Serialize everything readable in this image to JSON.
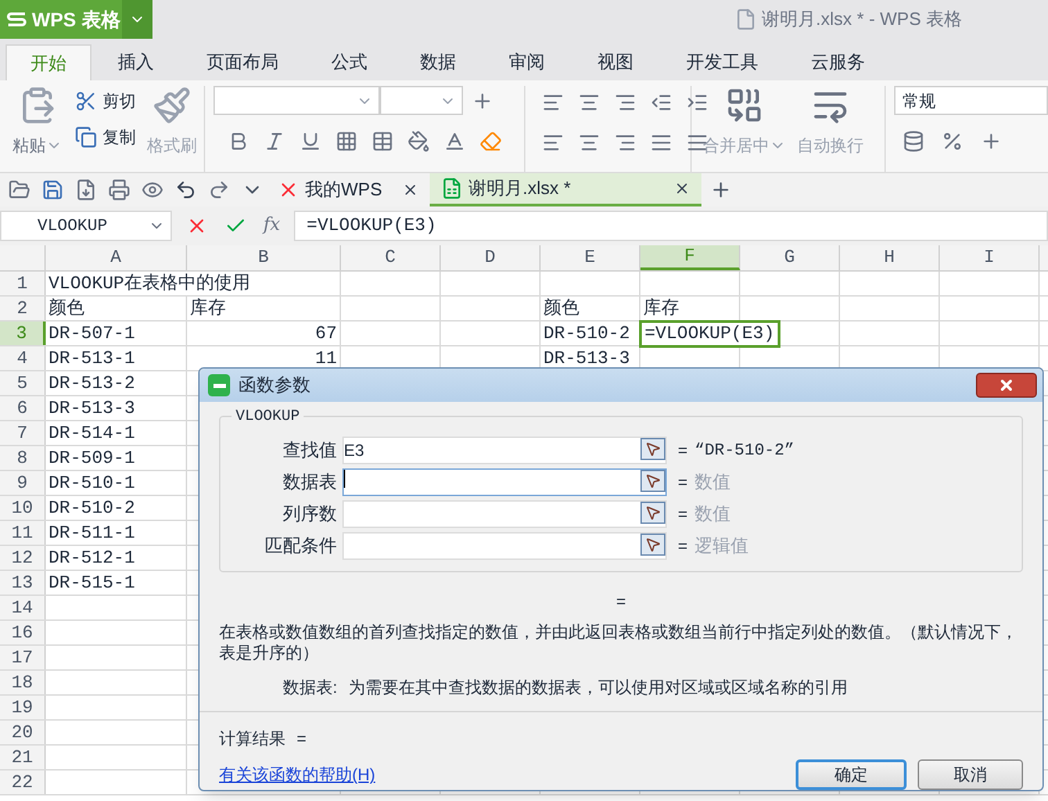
{
  "app_button": {
    "label": "WPS 表格"
  },
  "window_title": "谢明月.xlsx * - WPS 表格",
  "menu_tabs": [
    {
      "label": "开始",
      "selected": true
    },
    {
      "label": "插入",
      "selected": false
    },
    {
      "label": "页面布局",
      "selected": false
    },
    {
      "label": "公式",
      "selected": false
    },
    {
      "label": "数据",
      "selected": false
    },
    {
      "label": "审阅",
      "selected": false
    },
    {
      "label": "视图",
      "selected": false
    },
    {
      "label": "开发工具",
      "selected": false
    },
    {
      "label": "云服务",
      "selected": false
    }
  ],
  "ribbon": {
    "paste": "粘贴",
    "cut": "剪切",
    "copy": "复制",
    "format_painter": "格式刷",
    "merge_center": "合并居中",
    "wrap_text": "自动换行",
    "number_format": "常规"
  },
  "doc_tabs": [
    {
      "label": "我的WPS",
      "selected": false,
      "kind": "home"
    },
    {
      "label": "谢明月.xlsx *",
      "selected": true,
      "kind": "sheet"
    }
  ],
  "formula_bar": {
    "name_box": "VLOOKUP",
    "fx_label": "fx",
    "formula": "=VLOOKUP(E3)"
  },
  "sheet": {
    "columns": [
      {
        "label": "A",
        "selected": false
      },
      {
        "label": "B",
        "selected": false
      },
      {
        "label": "C",
        "selected": false
      },
      {
        "label": "D",
        "selected": false
      },
      {
        "label": "E",
        "selected": false
      },
      {
        "label": "F",
        "selected": true
      },
      {
        "label": "G",
        "selected": false
      },
      {
        "label": "H",
        "selected": false
      },
      {
        "label": "I",
        "selected": false
      }
    ],
    "rows": [
      {
        "number": "1",
        "selected": false,
        "cells": [
          {
            "text": "VLOOKUP在表格中的使用",
            "kind": "text"
          }
        ]
      },
      {
        "number": "2",
        "selected": false,
        "cells": [
          {
            "text": "颜色",
            "kind": "text"
          },
          {
            "text": "库存",
            "kind": "text"
          },
          null,
          null,
          {
            "text": "颜色",
            "kind": "text"
          },
          {
            "text": "库存",
            "kind": "text"
          }
        ]
      },
      {
        "number": "3",
        "selected": true,
        "cells": [
          {
            "text": "DR-507-1",
            "kind": "text"
          },
          {
            "text": "67",
            "kind": "number"
          },
          null,
          null,
          {
            "text": "DR-510-2",
            "kind": "text"
          },
          {
            "text": "=VLOOKUP(E3)",
            "kind": "editing"
          }
        ]
      },
      {
        "number": "4",
        "selected": false,
        "cells": [
          {
            "text": "DR-513-1",
            "kind": "text"
          },
          {
            "text": "11",
            "kind": "number"
          },
          null,
          null,
          {
            "text": "DR-513-3",
            "kind": "text"
          }
        ]
      },
      {
        "number": "5",
        "selected": false,
        "cells": [
          {
            "text": "DR-513-2",
            "kind": "text"
          }
        ]
      },
      {
        "number": "6",
        "selected": false,
        "cells": [
          {
            "text": "DR-513-3",
            "kind": "text"
          }
        ]
      },
      {
        "number": "7",
        "selected": false,
        "cells": [
          {
            "text": "DR-514-1",
            "kind": "text"
          }
        ]
      },
      {
        "number": "8",
        "selected": false,
        "cells": [
          {
            "text": "DR-509-1",
            "kind": "text"
          }
        ]
      },
      {
        "number": "9",
        "selected": false,
        "cells": [
          {
            "text": "DR-510-1",
            "kind": "text"
          }
        ]
      },
      {
        "number": "10",
        "selected": false,
        "cells": [
          {
            "text": "DR-510-2",
            "kind": "text"
          }
        ]
      },
      {
        "number": "11",
        "selected": false,
        "cells": [
          {
            "text": "DR-511-1",
            "kind": "text"
          }
        ]
      },
      {
        "number": "12",
        "selected": false,
        "cells": [
          {
            "text": "DR-512-1",
            "kind": "text"
          }
        ]
      },
      {
        "number": "13",
        "selected": false,
        "cells": [
          {
            "text": "DR-515-1",
            "kind": "text"
          }
        ]
      },
      {
        "number": "14",
        "selected": false,
        "cells": []
      },
      {
        "number": "16",
        "selected": false,
        "cells": []
      },
      {
        "number": "17",
        "selected": false,
        "cells": []
      },
      {
        "number": "18",
        "selected": false,
        "cells": []
      },
      {
        "number": "19",
        "selected": false,
        "cells": []
      },
      {
        "number": "20",
        "selected": false,
        "cells": []
      },
      {
        "number": "21",
        "selected": false,
        "cells": []
      },
      {
        "number": "22",
        "selected": false,
        "cells": []
      }
    ]
  },
  "dialog": {
    "title": "函数参数",
    "function_name": "VLOOKUP",
    "arguments": [
      {
        "label": "查找值",
        "value": "E3",
        "focused": false,
        "sign": "=",
        "result": "“DR-510-2”",
        "result_is_hint": false
      },
      {
        "label": "数据表",
        "focused": true,
        "sign": "=",
        "result": "数值",
        "result_is_hint": true
      },
      {
        "label": "列序数",
        "focused": false,
        "sign": "=",
        "result": "数值",
        "result_is_hint": true
      },
      {
        "label": "匹配条件",
        "focused": false,
        "sign": "=",
        "result": "逻辑值",
        "result_is_hint": true
      }
    ],
    "formula_sign": "=",
    "description": "在表格或数值数组的首列查找指定的数值，并由此返回表格或数组当前行中指定列处的数值。（默认情况下，表是升序的）",
    "argument_help": {
      "label": "数据表:",
      "text": "为需要在其中查找数据的数据表，可以使用对区域或区域名称的引用"
    },
    "calc_result": {
      "label": "计算结果",
      "sign": "="
    },
    "help_link": "有关该函数的帮助(H)",
    "buttons": [
      {
        "label": "确定",
        "default": true
      },
      {
        "label": "取消",
        "default": false
      }
    ]
  }
}
